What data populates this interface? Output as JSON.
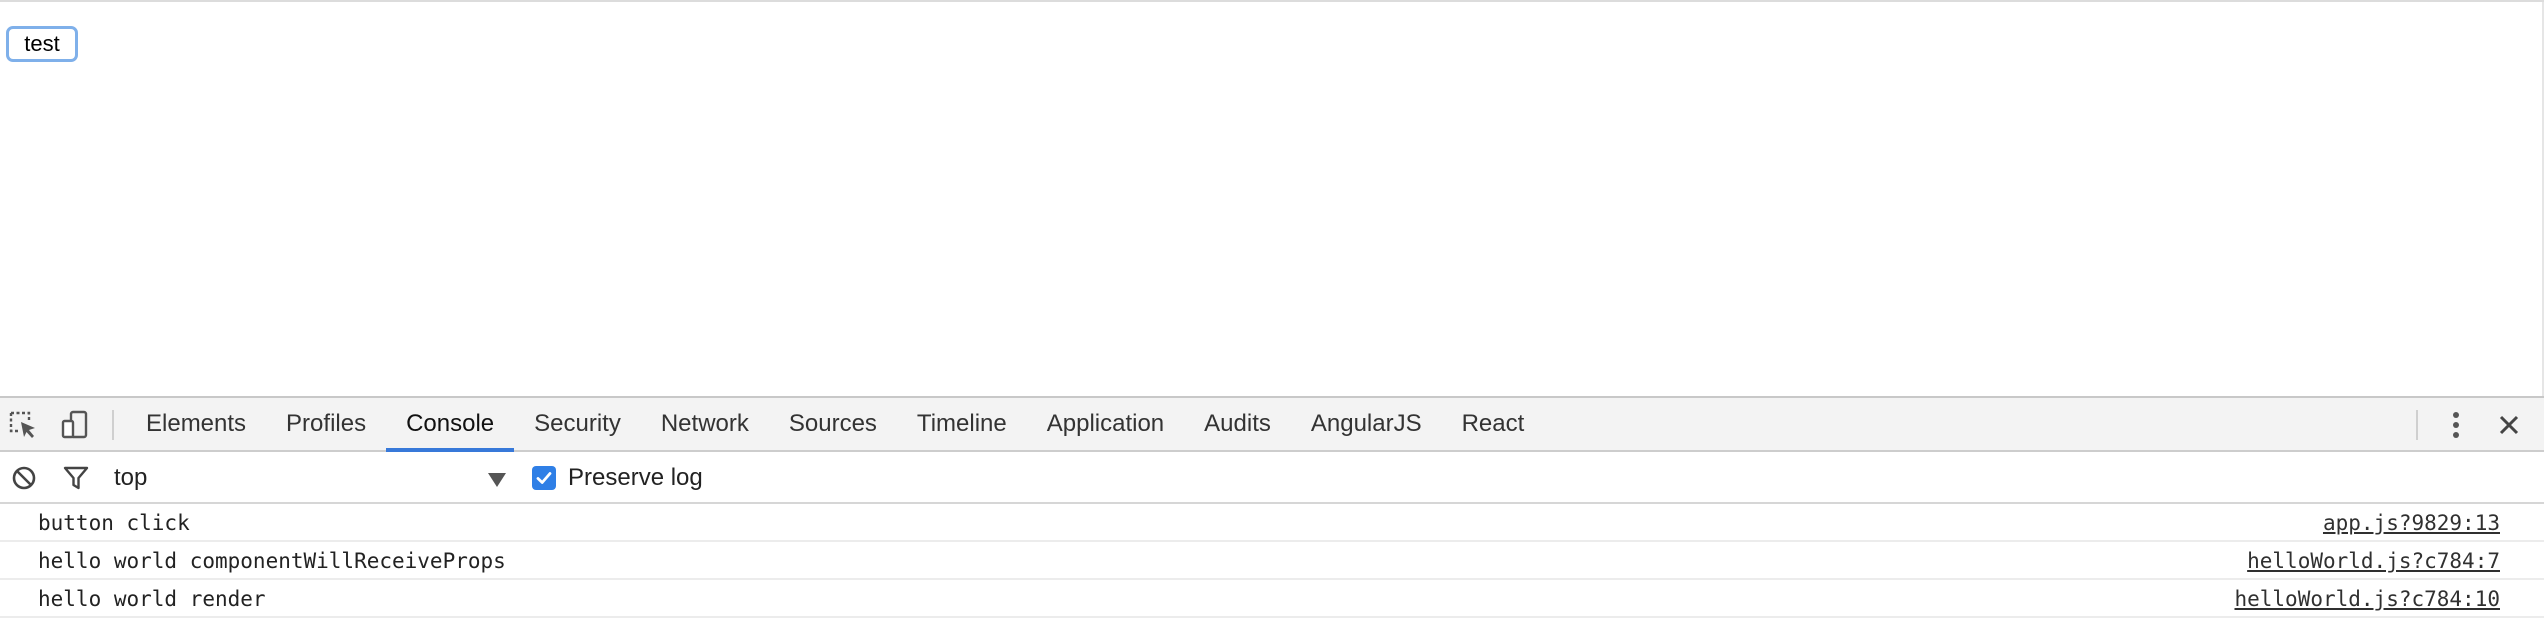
{
  "page": {
    "button_label": "test"
  },
  "devtools": {
    "tools": {
      "inspect_icon": "inspect-element-icon",
      "device_icon": "device-toolbar-icon"
    },
    "tabs": [
      {
        "label": "Elements",
        "active": false
      },
      {
        "label": "Profiles",
        "active": false
      },
      {
        "label": "Console",
        "active": true
      },
      {
        "label": "Security",
        "active": false
      },
      {
        "label": "Network",
        "active": false
      },
      {
        "label": "Sources",
        "active": false
      },
      {
        "label": "Timeline",
        "active": false
      },
      {
        "label": "Application",
        "active": false
      },
      {
        "label": "Audits",
        "active": false
      },
      {
        "label": "AngularJS",
        "active": false
      },
      {
        "label": "React",
        "active": false
      }
    ],
    "menu_icon": "more-vertical-icon",
    "close_icon": "close-icon",
    "accent_color": "#3879d9"
  },
  "console": {
    "clear_icon": "clear-console-icon",
    "filter_icon": "filter-icon",
    "context": "top",
    "preserve_log_label": "Preserve log",
    "preserve_log_checked": true,
    "messages": [
      {
        "text": "button click",
        "source": "app.js?9829:13"
      },
      {
        "text": "hello world componentWillReceiveProps",
        "source": "helloWorld.js?c784:7"
      },
      {
        "text": "hello world render",
        "source": "helloWorld.js?c784:10"
      }
    ]
  }
}
